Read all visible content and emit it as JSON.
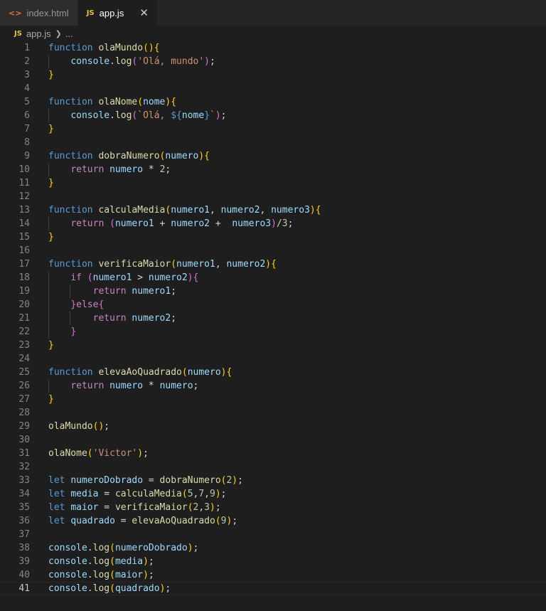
{
  "tabs": [
    {
      "label": "index.html",
      "icon": "html-icon"
    },
    {
      "label": "app.js",
      "icon": "js-icon",
      "active": true
    }
  ],
  "tab_icons": {
    "html": "<>",
    "js": "JS"
  },
  "breadcrumb": {
    "file": "app.js",
    "rest": "..."
  },
  "current_line": 41,
  "colors": {
    "keyword": "#569cd6",
    "control": "#c586c0",
    "function": "#dcdcaa",
    "variable": "#9cdcfe",
    "string": "#ce9178",
    "number": "#b5cea8",
    "bracket1": "#ffd700",
    "bracket2": "#da70d6",
    "bracket3": "#179fff"
  },
  "code": [
    [
      [
        "kw",
        "function "
      ],
      [
        "fn",
        "olaMundo"
      ],
      [
        "p1",
        "(){"
      ]
    ],
    [
      [
        "ob",
        "    "
      ],
      [
        "var",
        "console"
      ],
      [
        "ob",
        "."
      ],
      [
        "fn",
        "log"
      ],
      [
        "p2",
        "("
      ],
      [
        "str",
        "'Olá, mundo'"
      ],
      [
        "p2",
        ")"
      ],
      [
        "ob",
        ";"
      ]
    ],
    [
      [
        "p1",
        "}"
      ]
    ],
    [],
    [
      [
        "kw",
        "function "
      ],
      [
        "fn",
        "olaNome"
      ],
      [
        "p1",
        "("
      ],
      [
        "var",
        "nome"
      ],
      [
        "p1",
        "){"
      ]
    ],
    [
      [
        "ob",
        "    "
      ],
      [
        "var",
        "console"
      ],
      [
        "ob",
        "."
      ],
      [
        "fn",
        "log"
      ],
      [
        "p2",
        "("
      ],
      [
        "str",
        "`Olá, "
      ],
      [
        "kw",
        "${"
      ],
      [
        "var",
        "nome"
      ],
      [
        "kw",
        "}"
      ],
      [
        "str",
        "`"
      ],
      [
        "p2",
        ")"
      ],
      [
        "ob",
        ";"
      ]
    ],
    [
      [
        "p1",
        "}"
      ]
    ],
    [],
    [
      [
        "kw",
        "function "
      ],
      [
        "fn",
        "dobraNumero"
      ],
      [
        "p1",
        "("
      ],
      [
        "var",
        "numero"
      ],
      [
        "p1",
        "){"
      ]
    ],
    [
      [
        "ob",
        "    "
      ],
      [
        "ctl",
        "return "
      ],
      [
        "var",
        "numero"
      ],
      [
        "ob",
        " * "
      ],
      [
        "num",
        "2"
      ],
      [
        "ob",
        ";"
      ]
    ],
    [
      [
        "p1",
        "}"
      ]
    ],
    [],
    [
      [
        "kw",
        "function "
      ],
      [
        "fn",
        "calculaMedia"
      ],
      [
        "p1",
        "("
      ],
      [
        "var",
        "numero1"
      ],
      [
        "ob",
        ", "
      ],
      [
        "var",
        "numero2"
      ],
      [
        "ob",
        ", "
      ],
      [
        "var",
        "numero3"
      ],
      [
        "p1",
        "){"
      ]
    ],
    [
      [
        "ob",
        "    "
      ],
      [
        "ctl",
        "return "
      ],
      [
        "p2",
        "("
      ],
      [
        "var",
        "numero1"
      ],
      [
        "ob",
        " + "
      ],
      [
        "var",
        "numero2"
      ],
      [
        "ob",
        " +  "
      ],
      [
        "var",
        "numero3"
      ],
      [
        "p2",
        ")"
      ],
      [
        "ob",
        "/"
      ],
      [
        "num",
        "3"
      ],
      [
        "ob",
        ";"
      ]
    ],
    [
      [
        "p1",
        "}"
      ]
    ],
    [],
    [
      [
        "kw",
        "function "
      ],
      [
        "fn",
        "verificaMaior"
      ],
      [
        "p1",
        "("
      ],
      [
        "var",
        "numero1"
      ],
      [
        "ob",
        ", "
      ],
      [
        "var",
        "numero2"
      ],
      [
        "p1",
        "){"
      ]
    ],
    [
      [
        "ob",
        "    "
      ],
      [
        "ctl",
        "if "
      ],
      [
        "p2",
        "("
      ],
      [
        "var",
        "numero1"
      ],
      [
        "ob",
        " > "
      ],
      [
        "var",
        "numero2"
      ],
      [
        "p2",
        "){"
      ]
    ],
    [
      [
        "ob",
        "        "
      ],
      [
        "ctl",
        "return "
      ],
      [
        "var",
        "numero1"
      ],
      [
        "ob",
        ";"
      ]
    ],
    [
      [
        "ob",
        "    "
      ],
      [
        "p2",
        "}"
      ],
      [
        "ctl",
        "else"
      ],
      [
        "p2",
        "{"
      ]
    ],
    [
      [
        "ob",
        "        "
      ],
      [
        "ctl",
        "return "
      ],
      [
        "var",
        "numero2"
      ],
      [
        "ob",
        ";"
      ]
    ],
    [
      [
        "ob",
        "    "
      ],
      [
        "p2",
        "}"
      ]
    ],
    [
      [
        "p1",
        "}"
      ]
    ],
    [],
    [
      [
        "kw",
        "function "
      ],
      [
        "fn",
        "elevaAoQuadrado"
      ],
      [
        "p1",
        "("
      ],
      [
        "var",
        "numero"
      ],
      [
        "p1",
        "){"
      ]
    ],
    [
      [
        "ob",
        "    "
      ],
      [
        "ctl",
        "return "
      ],
      [
        "var",
        "numero"
      ],
      [
        "ob",
        " * "
      ],
      [
        "var",
        "numero"
      ],
      [
        "ob",
        ";"
      ]
    ],
    [
      [
        "p1",
        "}"
      ]
    ],
    [],
    [
      [
        "fn",
        "olaMundo"
      ],
      [
        "p1",
        "()"
      ],
      [
        "ob",
        ";"
      ]
    ],
    [],
    [
      [
        "fn",
        "olaNome"
      ],
      [
        "p1",
        "("
      ],
      [
        "str",
        "'Victor'"
      ],
      [
        "p1",
        ")"
      ],
      [
        "ob",
        ";"
      ]
    ],
    [],
    [
      [
        "kw",
        "let "
      ],
      [
        "var",
        "numeroDobrado"
      ],
      [
        "ob",
        " = "
      ],
      [
        "fn",
        "dobraNumero"
      ],
      [
        "p1",
        "("
      ],
      [
        "num",
        "2"
      ],
      [
        "p1",
        ")"
      ],
      [
        "ob",
        ";"
      ]
    ],
    [
      [
        "kw",
        "let "
      ],
      [
        "var",
        "media"
      ],
      [
        "ob",
        " = "
      ],
      [
        "fn",
        "calculaMedia"
      ],
      [
        "p1",
        "("
      ],
      [
        "num",
        "5"
      ],
      [
        "ob",
        ","
      ],
      [
        "num",
        "7"
      ],
      [
        "ob",
        ","
      ],
      [
        "num",
        "9"
      ],
      [
        "p1",
        ")"
      ],
      [
        "ob",
        ";"
      ]
    ],
    [
      [
        "kw",
        "let "
      ],
      [
        "var",
        "maior"
      ],
      [
        "ob",
        " = "
      ],
      [
        "fn",
        "verificaMaior"
      ],
      [
        "p1",
        "("
      ],
      [
        "num",
        "2"
      ],
      [
        "ob",
        ","
      ],
      [
        "num",
        "3"
      ],
      [
        "p1",
        ")"
      ],
      [
        "ob",
        ";"
      ]
    ],
    [
      [
        "kw",
        "let "
      ],
      [
        "var",
        "quadrado"
      ],
      [
        "ob",
        " = "
      ],
      [
        "fn",
        "elevaAoQuadrado"
      ],
      [
        "p1",
        "("
      ],
      [
        "num",
        "9"
      ],
      [
        "p1",
        ")"
      ],
      [
        "ob",
        ";"
      ]
    ],
    [],
    [
      [
        "var",
        "console"
      ],
      [
        "ob",
        "."
      ],
      [
        "fn",
        "log"
      ],
      [
        "p1",
        "("
      ],
      [
        "var",
        "numeroDobrado"
      ],
      [
        "p1",
        ")"
      ],
      [
        "ob",
        ";"
      ]
    ],
    [
      [
        "var",
        "console"
      ],
      [
        "ob",
        "."
      ],
      [
        "fn",
        "log"
      ],
      [
        "p1",
        "("
      ],
      [
        "var",
        "media"
      ],
      [
        "p1",
        ")"
      ],
      [
        "ob",
        ";"
      ]
    ],
    [
      [
        "var",
        "console"
      ],
      [
        "ob",
        "."
      ],
      [
        "fn",
        "log"
      ],
      [
        "p1",
        "("
      ],
      [
        "var",
        "maior"
      ],
      [
        "p1",
        ")"
      ],
      [
        "ob",
        ";"
      ]
    ],
    [
      [
        "var",
        "console"
      ],
      [
        "ob",
        "."
      ],
      [
        "fn",
        "log"
      ],
      [
        "p1",
        "("
      ],
      [
        "var",
        "quadrado"
      ],
      [
        "p1",
        ")"
      ],
      [
        "ob",
        ";"
      ]
    ]
  ]
}
